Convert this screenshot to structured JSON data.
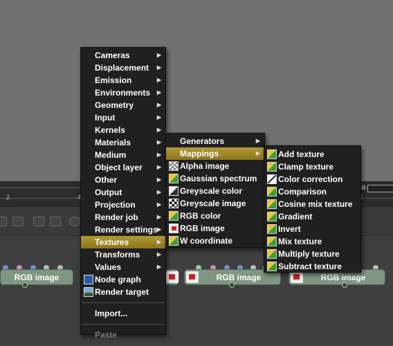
{
  "timeline": {
    "ticks": [
      "2",
      "4",
      "2"
    ],
    "mem_label": "MB"
  },
  "nodes": [
    {
      "label": "RGB image"
    },
    {
      "label": "RGB image"
    },
    {
      "label": "RGB image"
    }
  ],
  "main_menu": {
    "items": [
      {
        "label": "Cameras",
        "submenu": true
      },
      {
        "label": "Displacement",
        "submenu": true
      },
      {
        "label": "Emission",
        "submenu": true
      },
      {
        "label": "Environments",
        "submenu": true
      },
      {
        "label": "Geometry",
        "submenu": true
      },
      {
        "label": "Input",
        "submenu": true
      },
      {
        "label": "Kernels",
        "submenu": true
      },
      {
        "label": "Materials",
        "submenu": true
      },
      {
        "label": "Medium",
        "submenu": true
      },
      {
        "label": "Object layer",
        "submenu": true
      },
      {
        "label": "Other",
        "submenu": true
      },
      {
        "label": "Output",
        "submenu": true
      },
      {
        "label": "Projection",
        "submenu": true
      },
      {
        "label": "Render job",
        "submenu": true
      },
      {
        "label": "Render settings",
        "submenu": true
      },
      {
        "label": "Textures",
        "submenu": true,
        "highlighted": true
      },
      {
        "label": "Transforms",
        "submenu": true
      },
      {
        "label": "Values",
        "submenu": true
      },
      {
        "label": "Node graph",
        "icon": "node-graph-icon"
      },
      {
        "label": "Render target",
        "icon": "render-target-icon"
      }
    ],
    "import_label": "Import...",
    "paste_label": "Paste"
  },
  "textures_menu": {
    "items": [
      {
        "label": "Generators",
        "submenu": true
      },
      {
        "label": "Mappings",
        "submenu": true,
        "highlighted": true
      },
      {
        "label": "Alpha image",
        "icon": "alpha-image-icon"
      },
      {
        "label": "Gaussian spectrum",
        "icon": "texture-icon"
      },
      {
        "label": "Greyscale color",
        "icon": "greyscale-color-icon"
      },
      {
        "label": "Greyscale image",
        "icon": "greyscale-image-icon"
      },
      {
        "label": "RGB color",
        "icon": "texture-icon"
      },
      {
        "label": "RGB image",
        "icon": "rgb-image-icon"
      },
      {
        "label": "W coordinate",
        "icon": "texture-icon"
      }
    ]
  },
  "mappings_menu": {
    "items": [
      {
        "label": "Add texture",
        "icon": "texture-icon"
      },
      {
        "label": "Clamp texture",
        "icon": "texture-icon"
      },
      {
        "label": "Color correction",
        "icon": "color-correction-icon"
      },
      {
        "label": "Comparison",
        "icon": "texture-icon"
      },
      {
        "label": "Cosine mix texture",
        "icon": "texture-icon"
      },
      {
        "label": "Gradient",
        "icon": "texture-icon"
      },
      {
        "label": "Invert",
        "icon": "texture-icon"
      },
      {
        "label": "Mix texture",
        "icon": "texture-icon"
      },
      {
        "label": "Multiply texture",
        "icon": "texture-icon"
      },
      {
        "label": "Subtract texture",
        "icon": "texture-icon"
      }
    ]
  },
  "colors": {
    "highlight": "#a68b2a",
    "node_fill": "#7e9682",
    "menu_bg": "#202020"
  }
}
